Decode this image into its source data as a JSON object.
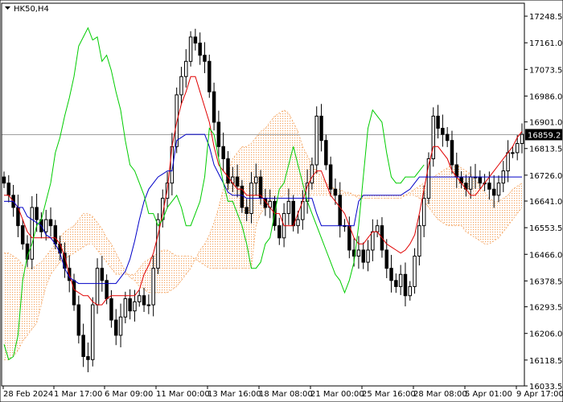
{
  "chart_data": {
    "type": "candlestick",
    "title": "HK50,H4",
    "current_price": "16859.2",
    "ylim": [
      16033.5,
      17291
    ],
    "y_ticks": [
      "17248.5",
      "17161.0",
      "17073.5",
      "16986.0",
      "16901.0",
      "16813.5",
      "16726.0",
      "16641.0",
      "16553.5",
      "16466.0",
      "16378.5",
      "16293.5",
      "16206.0",
      "16118.5",
      "16033.5"
    ],
    "x_ticks": [
      "28 Feb 2024",
      "1 Mar 17:00",
      "6 Mar 09:00",
      "11 Mar 00:00",
      "13 Mar 16:00",
      "18 Mar 08:00",
      "21 Mar 00:00",
      "25 Mar 16:00",
      "28 Mar 08:00",
      "5 Apr 01:00",
      "9 Apr 17:00"
    ],
    "colors": {
      "candles": "#000000",
      "tenkan": "#e00000",
      "kijun": "#0000c8",
      "chikou": "#00cc00",
      "cloud": "#f4a460",
      "price_line": "#a0a0a0"
    },
    "series": [
      {
        "name": "close",
        "values": [
          16700,
          16660,
          16620,
          16560,
          16500,
          16450,
          16620,
          16580,
          16540,
          16580,
          16560,
          16500,
          16470,
          16420,
          16380,
          16300,
          16200,
          16130,
          16120,
          16300,
          16420,
          16380,
          16320,
          16250,
          16200,
          16260,
          16320,
          16280,
          16310,
          16330,
          16300,
          16300,
          16420,
          16580,
          16650,
          16700,
          16820,
          16990,
          17050,
          17100,
          17180,
          17160,
          17120,
          17100,
          17000,
          16900,
          16820,
          16780,
          16700,
          16720,
          16690,
          16620,
          16600,
          16700,
          16720,
          16650,
          16620,
          16640,
          16560,
          16520,
          16600,
          16640,
          16560,
          16580,
          16640,
          16700,
          16760,
          16920,
          16840,
          16760,
          16680,
          16660,
          16560,
          16560,
          16480,
          16460,
          16480,
          16440,
          16480,
          16540,
          16560,
          16480,
          16420,
          16380,
          16360,
          16400,
          16330,
          16360,
          16460,
          16560,
          16650,
          16780,
          16920,
          16880,
          16860,
          16840,
          16760,
          16720,
          16700,
          16680,
          16720,
          16720,
          16700,
          16700,
          16680,
          16660,
          16700,
          16740,
          16800,
          16800,
          16830,
          16860
        ]
      },
      {
        "name": "tenkan",
        "values": [
          16660,
          16660,
          16640,
          16620,
          16580,
          16540,
          16520,
          16520,
          16520,
          16520,
          16520,
          16520,
          16500,
          16460,
          16400,
          16350,
          16340,
          16330,
          16330,
          16310,
          16300,
          16300,
          16320,
          16330,
          16330,
          16330,
          16330,
          16330,
          16330,
          16350,
          16400,
          16430,
          16470,
          16530,
          16600,
          16680,
          16820,
          16900,
          16960,
          17000,
          17050,
          17050,
          17000,
          16950,
          16900,
          16820,
          16760,
          16740,
          16720,
          16700,
          16680,
          16680,
          16660,
          16660,
          16660,
          16660,
          16640,
          16620,
          16600,
          16600,
          16560,
          16560,
          16560,
          16600,
          16640,
          16690,
          16720,
          16740,
          16740,
          16700,
          16660,
          16640,
          16620,
          16600,
          16560,
          16520,
          16500,
          16500,
          16520,
          16540,
          16540,
          16520,
          16500,
          16490,
          16480,
          16470,
          16480,
          16500,
          16530,
          16600,
          16680,
          16760,
          16820,
          16820,
          16800,
          16780,
          16740,
          16720,
          16700,
          16680,
          16660,
          16660,
          16680,
          16700,
          16720,
          16740,
          16760,
          16780,
          16800,
          16820,
          16850,
          16870
        ]
      },
      {
        "name": "kijun",
        "values": [
          16640,
          16640,
          16640,
          16620,
          16620,
          16590,
          16580,
          16570,
          16560,
          16530,
          16520,
          16500,
          16470,
          16420,
          16390,
          16380,
          16370,
          16370,
          16370,
          16370,
          16370,
          16370,
          16370,
          16370,
          16370,
          16390,
          16410,
          16450,
          16510,
          16580,
          16640,
          16680,
          16700,
          16720,
          16730,
          16740,
          16740,
          16840,
          16850,
          16860,
          16860,
          16860,
          16860,
          16860,
          16820,
          16760,
          16730,
          16700,
          16670,
          16660,
          16660,
          16660,
          16650,
          16650,
          16650,
          16650,
          16650,
          16650,
          16650,
          16650,
          16650,
          16650,
          16650,
          16650,
          16650,
          16650,
          16650,
          16600,
          16560,
          16560,
          16560,
          16560,
          16560,
          16560,
          16560,
          16560,
          16640,
          16660,
          16660,
          16660,
          16660,
          16660,
          16660,
          16660,
          16660,
          16660,
          16670,
          16680,
          16700,
          16720,
          16720,
          16720,
          16720,
          16720,
          16720,
          16720,
          16720,
          16720,
          16720,
          16720,
          16720,
          16720,
          16720,
          16720,
          16720,
          16720,
          16720,
          16720,
          16720,
          16720,
          16720,
          16720
        ]
      },
      {
        "name": "chikou",
        "values": [
          16170,
          16120,
          16130,
          16200,
          16380,
          16460,
          16500,
          16560,
          16580,
          16640,
          16700,
          16800,
          16850,
          16920,
          16980,
          17050,
          17150,
          17180,
          17210,
          17170,
          17180,
          17100,
          17120,
          17070,
          17000,
          16940,
          16840,
          16760,
          16740,
          16700,
          16660,
          16600,
          16600,
          16560,
          16580,
          16620,
          16640,
          16660,
          16620,
          16560,
          16560,
          16600,
          16640,
          16720,
          16880,
          16860,
          16780,
          16700,
          16640,
          16640,
          16600,
          16560,
          16500,
          16420,
          16420,
          16440,
          16500,
          16520,
          16600,
          16680,
          16700,
          16760,
          16820,
          16760,
          16700,
          16640,
          16600,
          16560,
          16520,
          16480,
          16440,
          16400,
          16380,
          16340,
          16380,
          16440,
          16560,
          16720,
          16880,
          16940,
          16920,
          16900,
          16800,
          16720,
          16700,
          16700,
          16720,
          16720,
          16720,
          16740,
          16760
        ]
      },
      {
        "name": "senkou_a",
        "values": [
          16470,
          16470,
          16460,
          16450,
          16430,
          16420,
          16420,
          16430,
          16440,
          16460,
          16480,
          16500,
          16520,
          16540,
          16550,
          16560,
          16580,
          16600,
          16600,
          16590,
          16570,
          16550,
          16520,
          16500,
          16470,
          16440,
          16410,
          16390,
          16380,
          16360,
          16350,
          16340,
          16340,
          16340,
          16340,
          16340,
          16350,
          16360,
          16380,
          16400,
          16420,
          16450,
          16480,
          16500,
          16530,
          16570,
          16620,
          16680,
          16730,
          16780,
          16800,
          16820,
          16820,
          16830,
          16850,
          16870,
          16880,
          16900,
          16920,
          16930,
          16940,
          16930,
          16900,
          16870,
          16820,
          16790,
          16760,
          16740,
          16720,
          16700,
          16690,
          16680,
          16680,
          16670,
          16670,
          16660,
          16650,
          16650,
          16650,
          16650,
          16650,
          16650,
          16650,
          16650,
          16650,
          16650,
          16660,
          16670,
          16680,
          16690,
          16700,
          16710,
          16720,
          16730,
          16740,
          16750,
          16760,
          16760,
          16750,
          16740,
          16730,
          16710,
          16690,
          16670,
          16650,
          16640,
          16640,
          16650,
          16660,
          16680,
          16690,
          16700,
          16700
        ]
      },
      {
        "name": "senkou_b",
        "values": [
          16120,
          16120,
          16130,
          16150,
          16180,
          16200,
          16220,
          16240,
          16300,
          16360,
          16400,
          16420,
          16440,
          16450,
          16460,
          16470,
          16480,
          16490,
          16500,
          16500,
          16480,
          16460,
          16440,
          16420,
          16400,
          16400,
          16400,
          16400,
          16400,
          16420,
          16440,
          16450,
          16460,
          16470,
          16480,
          16480,
          16470,
          16460,
          16460,
          16460,
          16460,
          16450,
          16440,
          16430,
          16420,
          16420,
          16420,
          16420,
          16420,
          16420,
          16420,
          16420,
          16420,
          16420,
          16560,
          16600,
          16620,
          16640,
          16650,
          16650,
          16660,
          16660,
          16660,
          16660,
          16660,
          16660,
          16660,
          16660,
          16660,
          16660,
          16660,
          16660,
          16660,
          16660,
          16660,
          16660,
          16660,
          16660,
          16660,
          16660,
          16660,
          16660,
          16660,
          16660,
          16660,
          16660,
          16660,
          16660,
          16660,
          16650,
          16640,
          16620,
          16600,
          16580,
          16570,
          16560,
          16560,
          16560,
          16560,
          16540,
          16530,
          16520,
          16510,
          16500,
          16500,
          16510,
          16520,
          16540,
          16560,
          16580,
          16600,
          16620,
          16640
        ]
      }
    ]
  }
}
